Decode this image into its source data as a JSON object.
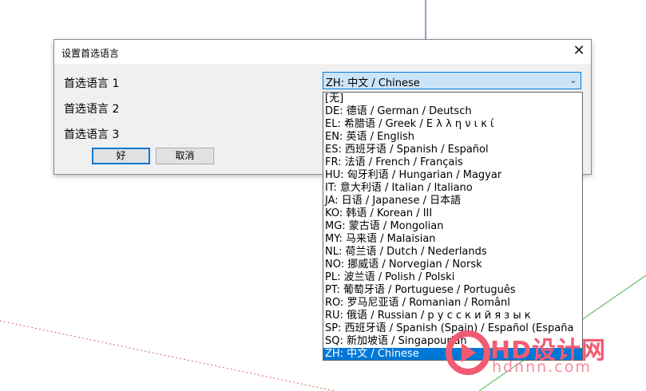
{
  "dialog": {
    "title": "设置首选语言",
    "close_glyph": "✕",
    "labels": [
      "首选语言 1",
      "首选语言 2",
      "首选语言 3"
    ],
    "ok_label": "好",
    "cancel_label": "取消"
  },
  "combo": {
    "value": "ZH: 中文 / Chinese",
    "arrow_glyph": "⌄"
  },
  "dropdown": {
    "options": [
      "[无]",
      "DE: 德语 / German / Deutsch",
      "EL: 希腊语 / Greek / Ε λ λ η ν ι κ ί",
      "EN: 英语 / English",
      "ES: 西班牙语 / Spanish / Español",
      "FR: 法语 / French / Français",
      "HU: 匈牙利语 / Hungarian / Magyar",
      "IT: 意大利语 / Italian / Italiano",
      "JA: 日语 / Japanese / 日本語",
      "KO: 韩语 / Korean / III",
      "MG: 蒙古语 / Mongolian",
      "MY: 马来语 / Malaisian",
      "NL: 荷兰语 / Dutch / Nederlands",
      "NO: 挪威语 / Norvegian / Norsk",
      "PL: 波兰语 / Polish / Polski",
      "PT: 葡萄牙语 / Portuguese / Português",
      "RO: 罗马尼亚语 / Romanian / Românl",
      "RU: 俄语 / Russian / р у с с к и й  я з ы к",
      "SP: 西班牙语 / Spanish (Spain) / Español (España",
      "SQ: 新加坡语 / Singapourian",
      "ZH: 中文 / Chinese"
    ],
    "selected_index": 20
  },
  "watermark": {
    "title": "HD设计网",
    "subtitle": "hdnnn.com"
  },
  "colors": {
    "accent": "#0078d7",
    "watermark": "#f25a72"
  }
}
